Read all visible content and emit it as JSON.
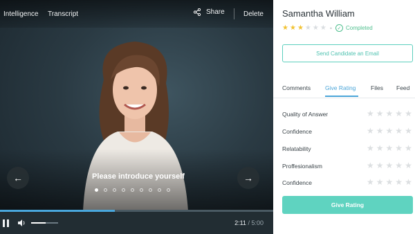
{
  "video": {
    "tabs": [
      "Intelligence",
      "Transcript"
    ],
    "share_label": "Share",
    "delete_label": "Delete",
    "prompt": "Please introduce yourself",
    "slide_count": 9,
    "active_slide": 1,
    "progress_fraction": 0.42,
    "volume_fraction": 0.55,
    "time_current": "2:11",
    "time_total": "/ 5:00"
  },
  "candidate": {
    "name": "Samantha William",
    "rating": 3,
    "rating_max": 6,
    "status": "Completed"
  },
  "email_button_label": "Send Candidate an Email",
  "tabs": [
    "Comments",
    "Give Rating",
    "Files",
    "Feed"
  ],
  "active_tab": "Give Rating",
  "criteria": [
    "Quality of Answer",
    "Confidence",
    "Relatability",
    "Proffesionalism",
    "Confidence"
  ],
  "criteria_star_count": 5,
  "give_rating_label": "Give Rating",
  "colors": {
    "accent_teal": "#5fd3c0",
    "accent_blue": "#4aa5d8",
    "star_gold": "#f1c232",
    "status_green": "#4fbf8e"
  }
}
